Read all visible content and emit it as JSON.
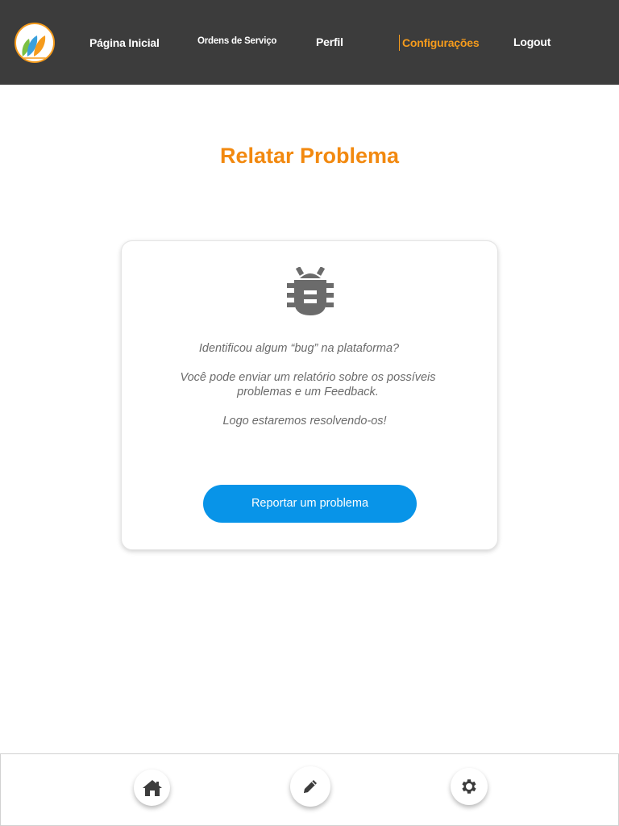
{
  "header": {
    "logo_icon": "leaves-logo-icon",
    "nav": [
      {
        "label": "Página Inicial",
        "active": false
      },
      {
        "label": "Ordens de Serviço",
        "active": false
      },
      {
        "label": "Perfil",
        "active": false
      },
      {
        "label": "Configurações",
        "active": true
      },
      {
        "label": "Logout",
        "active": false
      }
    ]
  },
  "page": {
    "title": "Relatar Problema"
  },
  "card": {
    "icon": "bug-icon",
    "line1": "Identificou algum “bug” na plataforma?",
    "line2": "Você pode enviar um relatório sobre os possíveis problemas e um Feedback.",
    "line3": "Logo estaremos resolvendo-os!",
    "button_label": "Reportar um problema"
  },
  "bottom_bar": {
    "items": [
      {
        "icon": "home-icon"
      },
      {
        "icon": "pencil-icon"
      },
      {
        "icon": "gear-icon"
      }
    ]
  },
  "colors": {
    "header_bg": "#3c3c3c",
    "accent": "#f2890f",
    "button": "#0894e8",
    "text_gray": "#6b6b6b"
  }
}
